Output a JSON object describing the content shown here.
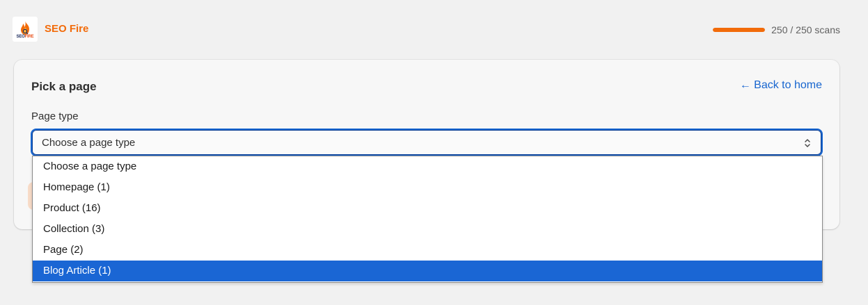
{
  "header": {
    "app_name": "SEO Fire",
    "logo": {
      "brand_primary": "SEO",
      "brand_secondary": "FIRE",
      "icon": "flame-icon"
    },
    "usage": {
      "text": "250 / 250 scans",
      "used": 250,
      "limit": 250,
      "color": "#f26b0a"
    }
  },
  "card": {
    "title": "Pick a page",
    "back_link": "← Back to home",
    "field_label": "Page type",
    "select": {
      "value": "Choose a page type",
      "icon": "select-arrows-icon"
    }
  },
  "dropdown": {
    "options": [
      {
        "label": "Choose a page type",
        "selected": false
      },
      {
        "label": "Homepage (1)",
        "selected": false
      },
      {
        "label": "Product (16)",
        "selected": false
      },
      {
        "label": "Collection (3)",
        "selected": false
      },
      {
        "label": "Page (2)",
        "selected": false
      },
      {
        "label": "Blog Article (1)",
        "selected": true
      }
    ]
  },
  "colors": {
    "accent": "#f26b0a",
    "link": "#1765cf",
    "selection": "#1a66d4"
  }
}
